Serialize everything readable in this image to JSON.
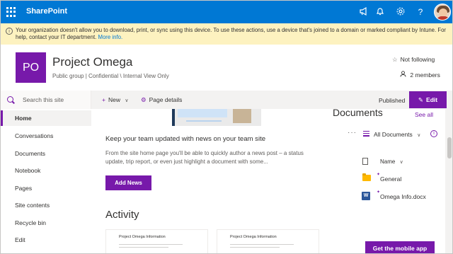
{
  "suitebar": {
    "brand": "SharePoint",
    "icons": [
      "megaphone-icon",
      "bell-icon",
      "gear-icon",
      "help-icon"
    ],
    "color": "#0078d4"
  },
  "banner": {
    "message": "Your organization doesn't allow you to download, print, or sync using this device. To use these actions, use a device that's joined to a domain or marked compliant by Intune. For help, contact your IT department.",
    "link": "More info."
  },
  "site": {
    "logo_text": "PO",
    "title": "Project Omega",
    "subtitle": "Public group | Confidential \\ Internal View Only",
    "follow": "Not following",
    "members": "2 members",
    "accent": "#7719aa"
  },
  "commandbar": {
    "search_placeholder": "Search this site",
    "new_label": "New",
    "page_details_label": "Page details",
    "published_label": "Published",
    "edit_label": "Edit"
  },
  "nav": {
    "items": [
      {
        "label": "Home",
        "active": true
      },
      {
        "label": "Conversations"
      },
      {
        "label": "Documents"
      },
      {
        "label": "Notebook"
      },
      {
        "label": "Pages"
      },
      {
        "label": "Site contents"
      },
      {
        "label": "Recycle bin"
      },
      {
        "label": "Edit"
      }
    ]
  },
  "news": {
    "title": "Keep your team updated with news on your team site",
    "body": "From the site home page you'll be able to quickly author a news post – a status update, trip report, or even just highlight a document with some...",
    "add_label": "Add News"
  },
  "activity": {
    "heading": "Activity",
    "cards": [
      {
        "title": "Project Omega Information"
      },
      {
        "title": "Project Omega Information"
      }
    ]
  },
  "documents": {
    "title": "Documents",
    "see_all": "See all",
    "view": "All Documents",
    "column_name": "Name",
    "rows": [
      {
        "name": "General",
        "icon": "folder-icon"
      },
      {
        "name": "Omega Info.docx",
        "icon": "word-file-icon"
      }
    ]
  },
  "mobile_button": "Get the mobile app"
}
